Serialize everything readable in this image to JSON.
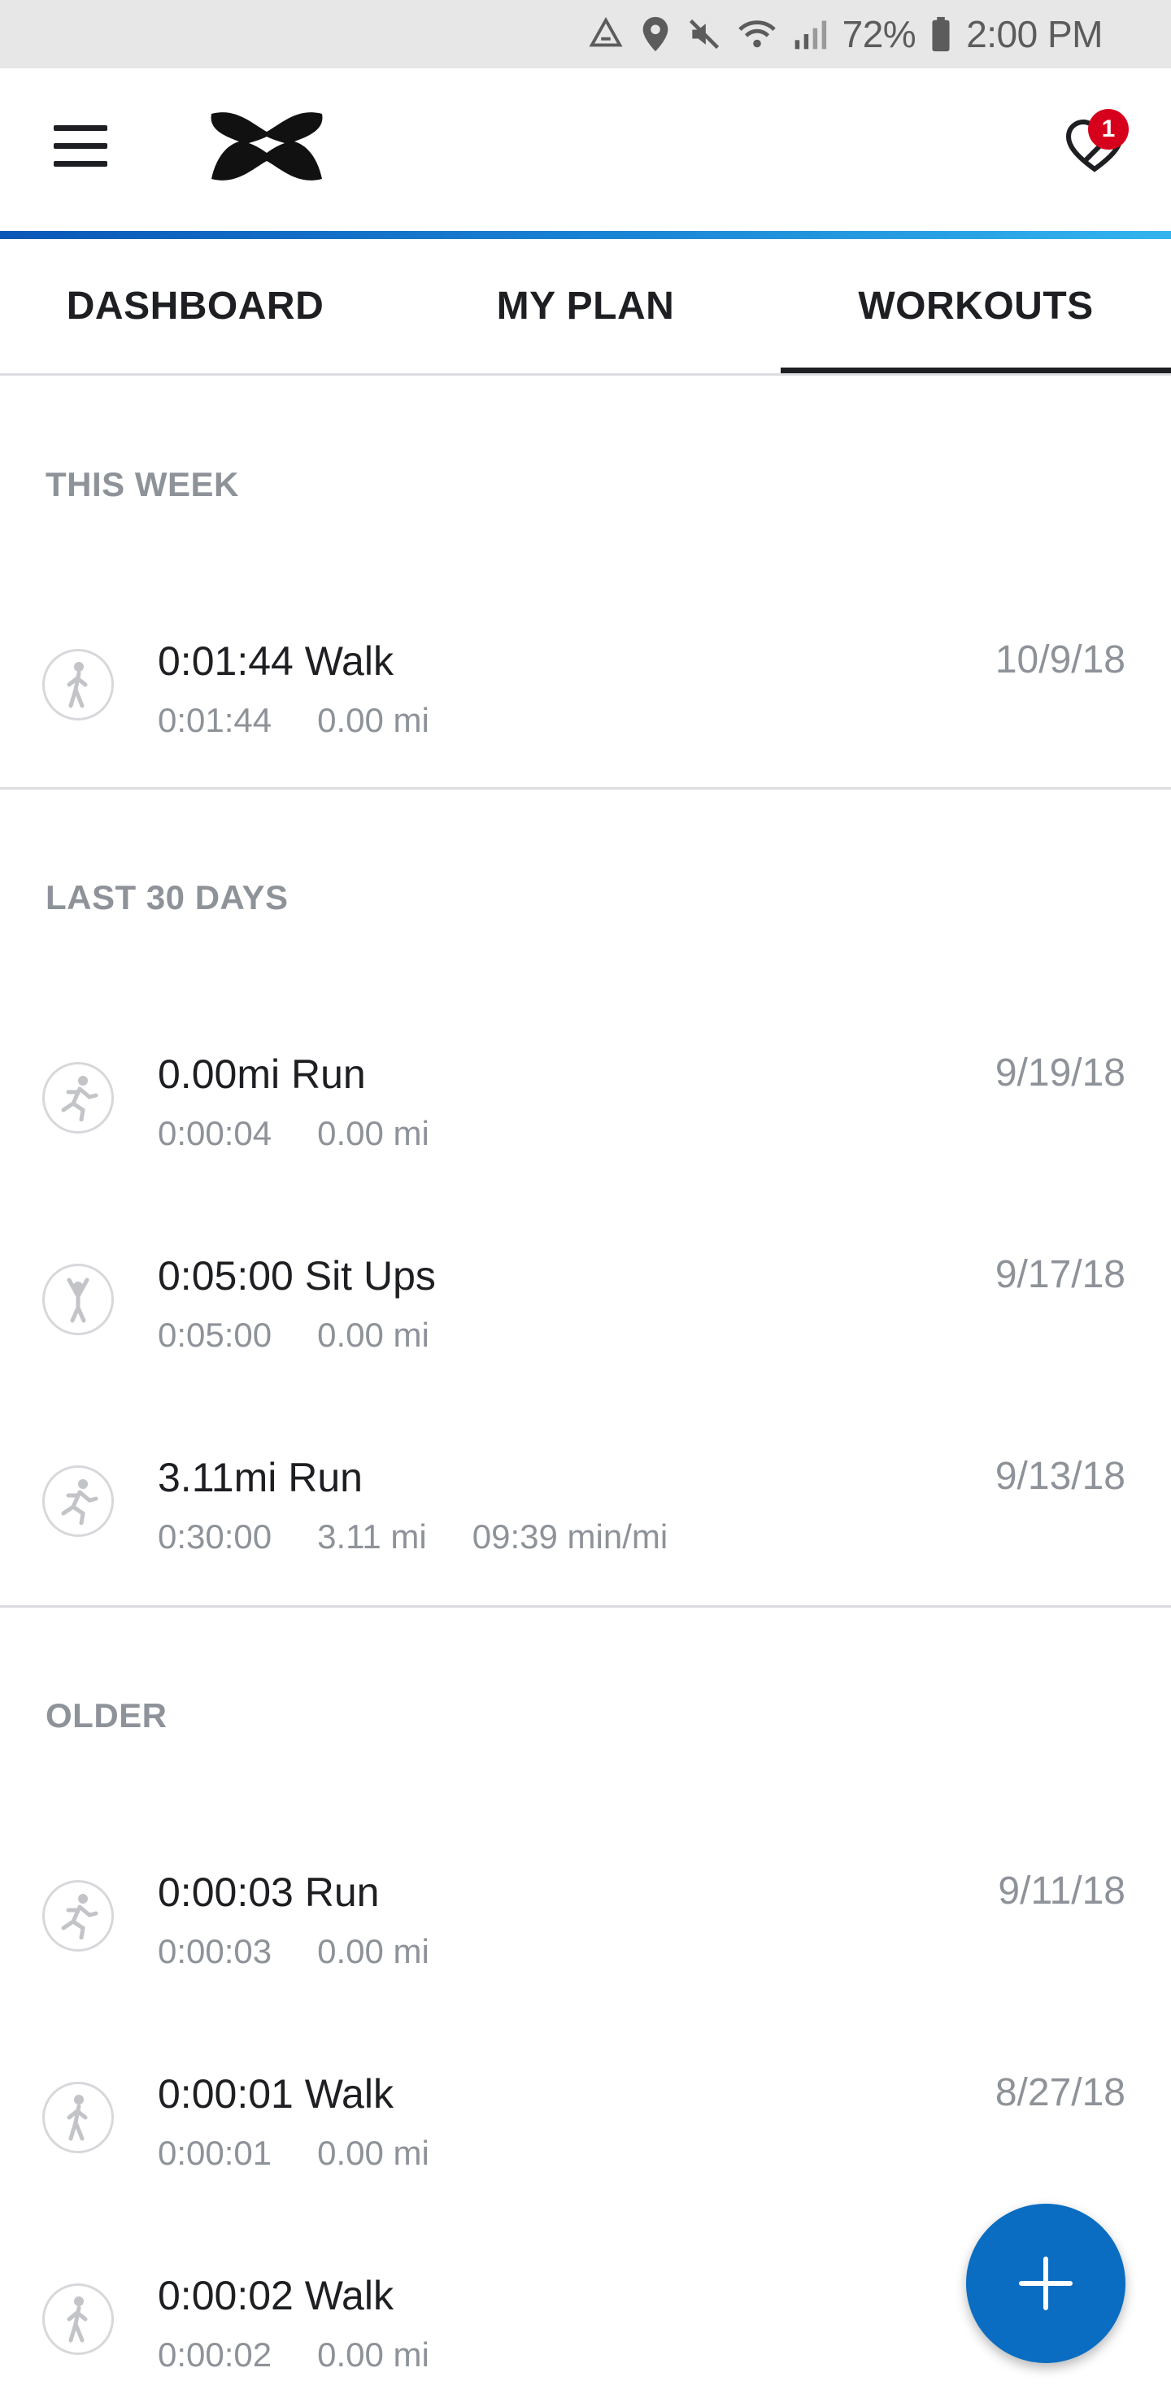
{
  "status_bar": {
    "battery": "72%",
    "time": "2:00 PM"
  },
  "header": {
    "notification_count": "1"
  },
  "tabs": [
    {
      "label": "DASHBOARD",
      "active": false
    },
    {
      "label": "MY PLAN",
      "active": false
    },
    {
      "label": "WORKOUTS",
      "active": true
    }
  ],
  "sections": [
    {
      "title": "THIS WEEK",
      "workouts": [
        {
          "icon": "walk-icon",
          "title": "0:01:44 Walk",
          "date": "10/9/18",
          "duration": "0:01:44",
          "distance": "0.00 mi",
          "pace": ""
        }
      ]
    },
    {
      "title": "LAST 30 DAYS",
      "workouts": [
        {
          "icon": "run-icon",
          "title": "0.00mi Run",
          "date": "9/19/18",
          "duration": "0:00:04",
          "distance": "0.00 mi",
          "pace": ""
        },
        {
          "icon": "sit-ups-icon",
          "title": "0:05:00 Sit Ups",
          "date": "9/17/18",
          "duration": "0:05:00",
          "distance": "0.00 mi",
          "pace": ""
        },
        {
          "icon": "run-icon",
          "title": "3.11mi Run",
          "date": "9/13/18",
          "duration": "0:30:00",
          "distance": "3.11 mi",
          "pace": "09:39 min/mi"
        }
      ]
    },
    {
      "title": "OLDER",
      "workouts": [
        {
          "icon": "run-icon",
          "title": "0:00:03 Run",
          "date": "9/11/18",
          "duration": "0:00:03",
          "distance": "0.00 mi",
          "pace": ""
        },
        {
          "icon": "walk-icon",
          "title": "0:00:01 Walk",
          "date": "8/27/18",
          "duration": "0:00:01",
          "distance": "0.00 mi",
          "pace": ""
        },
        {
          "icon": "walk-icon",
          "title": "0:00:02 Walk",
          "date": "",
          "duration": "0:00:02",
          "distance": "0.00 mi",
          "pace": ""
        }
      ]
    }
  ],
  "colors": {
    "accent": "#0a6dc2",
    "badge": "#d6001c",
    "muted_text": "#8e9299"
  }
}
